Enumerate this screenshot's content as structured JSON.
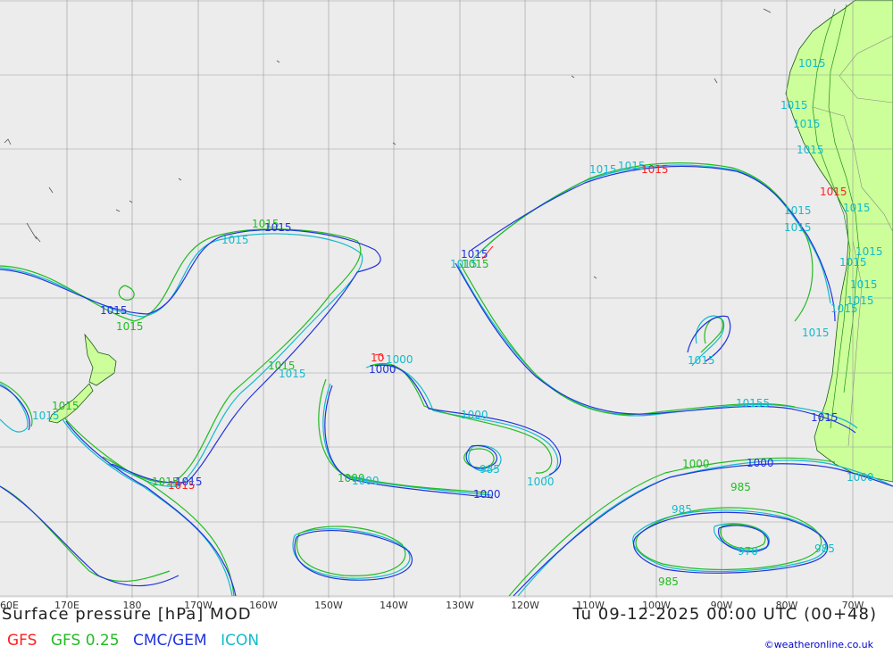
{
  "map": {
    "title": "Surface pressure [hPa] MOD",
    "datetime": "Tu 09-12-2025 00:00 UTC (00+48)",
    "credit": "©weatheronline.co.uk",
    "lon_labels": [
      "60E",
      "170E",
      "180",
      "170W",
      "160W",
      "150W",
      "140W",
      "130W",
      "120W",
      "110W",
      "100W",
      "90W",
      "80W",
      "70W"
    ],
    "legend": [
      {
        "label": "GFS",
        "color": "#ff2020"
      },
      {
        "label": "GFS 0.25",
        "color": "#22bb22"
      },
      {
        "label": "CMC/GEM",
        "color": "#2233dd"
      },
      {
        "label": "ICON",
        "color": "#11bbcc"
      }
    ],
    "colors": {
      "ocean": "#ececec",
      "land": "#ccff99",
      "grid": "#999999"
    }
  },
  "isobars": [
    {
      "text": "1015",
      "color": "#22bb22"
    },
    {
      "text": "1015",
      "color": "#2233dd"
    },
    {
      "text": "1015",
      "color": "#11bbcc"
    },
    {
      "text": "1015",
      "color": "#22bb22"
    },
    {
      "text": "1015",
      "color": "#2233dd"
    },
    {
      "text": "1015",
      "color": "#22bb22"
    },
    {
      "text": "1015",
      "color": "#2233dd"
    },
    {
      "text": "1015",
      "color": "#22bb22"
    },
    {
      "text": "1015",
      "color": "#22bb22"
    },
    {
      "text": "1015",
      "color": "#11bbcc"
    },
    {
      "text": "1015",
      "color": "#11bbcc"
    },
    {
      "text": "1015",
      "color": "#ff2020"
    },
    {
      "text": "1000",
      "color": "#2233dd"
    },
    {
      "text": "1000",
      "color": "#11bbcc"
    },
    {
      "text": "10",
      "color": "#ff2020"
    },
    {
      "text": "1000",
      "color": "#11bbcc"
    },
    {
      "text": "985",
      "color": "#11bbcc"
    },
    {
      "text": "1000",
      "color": "#11bbcc"
    },
    {
      "text": "1000",
      "color": "#22bb22"
    },
    {
      "text": "1000",
      "color": "#2233dd"
    },
    {
      "text": "1000",
      "color": "#11bbcc"
    },
    {
      "text": "1015",
      "color": "#11bbcc"
    },
    {
      "text": "1015",
      "color": "#22bb22"
    },
    {
      "text": "1015",
      "color": "#2233dd"
    },
    {
      "text": "1015",
      "color": "#11bbcc"
    },
    {
      "text": "1015",
      "color": "#11bbcc"
    },
    {
      "text": "1015",
      "color": "#ff2020"
    },
    {
      "text": "1015",
      "color": "#11bbcc"
    },
    {
      "text": "10155",
      "color": "#11bbcc"
    },
    {
      "text": "1000",
      "color": "#2233dd"
    },
    {
      "text": "1000",
      "color": "#22bb22"
    },
    {
      "text": "985",
      "color": "#22bb22"
    },
    {
      "text": "985",
      "color": "#11bbcc"
    },
    {
      "text": "970",
      "color": "#11bbcc"
    },
    {
      "text": "985",
      "color": "#11bbcc"
    },
    {
      "text": "985",
      "color": "#22bb22"
    },
    {
      "text": "1015",
      "color": "#11bbcc"
    },
    {
      "text": "1015",
      "color": "#11bbcc"
    },
    {
      "text": "1015",
      "color": "#11bbcc"
    },
    {
      "text": "1015",
      "color": "#11bbcc"
    },
    {
      "text": "1015",
      "color": "#11bbcc"
    },
    {
      "text": "1015",
      "color": "#11bbcc"
    },
    {
      "text": "1015",
      "color": "#ff2020"
    },
    {
      "text": "1015",
      "color": "#11bbcc"
    },
    {
      "text": "1015",
      "color": "#11bbcc"
    },
    {
      "text": "1015",
      "color": "#11bbcc"
    },
    {
      "text": "1015",
      "color": "#11bbcc"
    },
    {
      "text": "1015",
      "color": "#11bbcc"
    },
    {
      "text": "1015",
      "color": "#11bbcc"
    },
    {
      "text": "1015",
      "color": "#2233dd"
    },
    {
      "text": "1000",
      "color": "#11bbcc"
    },
    {
      "text": "1015",
      "color": "#11bbcc"
    }
  ]
}
